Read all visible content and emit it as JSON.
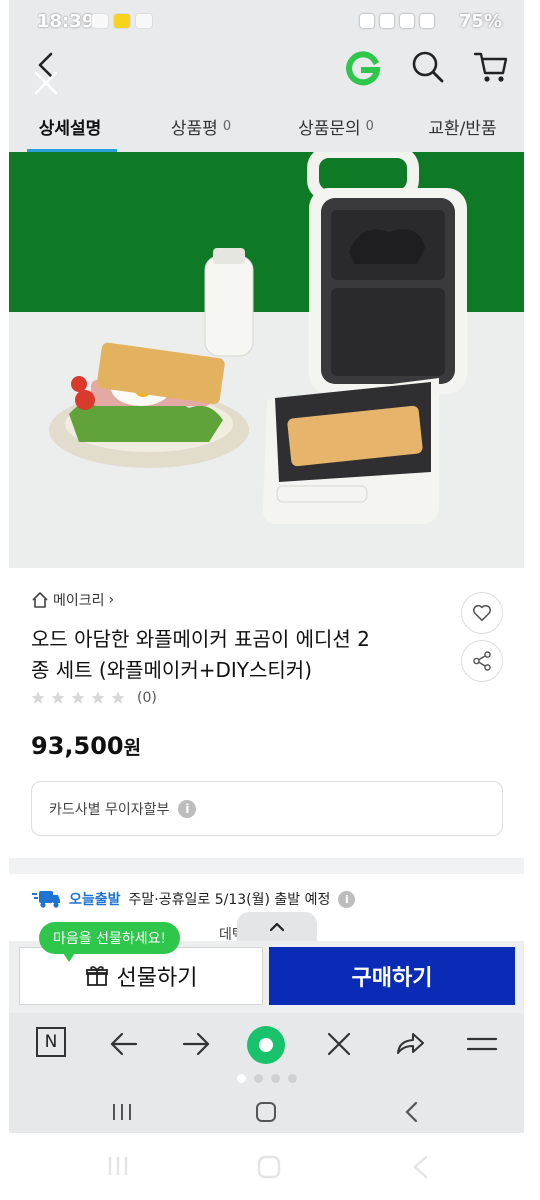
{
  "status_bar": {
    "time": "18:39",
    "battery": "75%"
  },
  "header": {
    "back_icon": "chevron-left-icon",
    "close_icon": "close-icon",
    "logo_letter": "G",
    "brand_color": "#2ec64b"
  },
  "tabs": [
    {
      "label": "상세설명",
      "count": ""
    },
    {
      "label": "상품평",
      "count": "0"
    },
    {
      "label": "상품문의",
      "count": "0"
    },
    {
      "label": "교환/반품",
      "count": ""
    }
  ],
  "product": {
    "brand": "메이크리",
    "brand_chevron": "›",
    "title_line1": "오드 아담한 와플메이커 표곰이 에디션 2",
    "title_line2": "종 세트 (와플메이커+DIY스티커)",
    "rating": 0,
    "review_count": "(0)",
    "price": "93,500",
    "price_unit": "원",
    "installment": "카드사별 무이자할부",
    "info_glyph": "i"
  },
  "shipping": {
    "today_label": "오늘출발",
    "message": "주말·공휴일로 5/13(월) 출발 예정",
    "partial": "데택배"
  },
  "actions": {
    "gift_bubble": "마음을 선물하세요!",
    "gift_label": "선물하기",
    "buy_label": "구매하기"
  },
  "browser_bar": {
    "n_label": "N",
    "icons": [
      "naver-n-icon",
      "back-arrow-icon",
      "forward-arrow-icon",
      "home-circle-icon",
      "close-icon",
      "share-icon",
      "menu-icon"
    ]
  },
  "colors": {
    "accent_green": "#2ec64b",
    "buy_blue": "#0a2bb5",
    "tab_underline": "#2aa0d8",
    "image_green": "#0e7a25"
  }
}
